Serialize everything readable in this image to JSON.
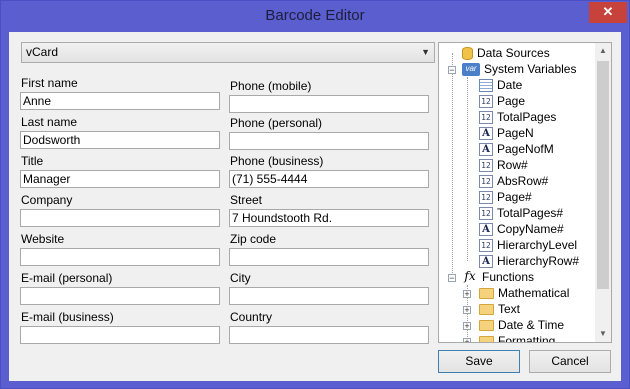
{
  "window": {
    "title": "Barcode Editor",
    "close_glyph": "✕"
  },
  "combo": {
    "value": "vCard",
    "arrow": "▼"
  },
  "fields": {
    "first_name": {
      "label": "First name",
      "value": "Anne"
    },
    "phone_mobile": {
      "label": "Phone (mobile)",
      "value": ""
    },
    "last_name": {
      "label": "Last name",
      "value": "Dodsworth"
    },
    "phone_personal": {
      "label": "Phone (personal)",
      "value": ""
    },
    "title": {
      "label": "Title",
      "value": "Manager"
    },
    "phone_business": {
      "label": "Phone (business)",
      "value": "(71) 555-4444"
    },
    "company": {
      "label": "Company",
      "value": ""
    },
    "street": {
      "label": "Street",
      "value": "7 Houndstooth Rd."
    },
    "website": {
      "label": "Website",
      "value": ""
    },
    "zip": {
      "label": "Zip code",
      "value": ""
    },
    "email_personal": {
      "label": "E-mail (personal)",
      "value": ""
    },
    "city": {
      "label": "City",
      "value": ""
    },
    "email_business": {
      "label": "E-mail (business)",
      "value": ""
    },
    "country": {
      "label": "Country",
      "value": ""
    }
  },
  "tree": {
    "data_sources": "Data Sources",
    "system_variables": "System Variables",
    "var_icon": "var",
    "num_icon": "12",
    "text_icon": "A",
    "fx_icon": "fx",
    "vars": [
      "Date",
      "Page",
      "TotalPages",
      "PageN",
      "PageNofM",
      "Row#",
      "AbsRow#",
      "Page#",
      "TotalPages#",
      "CopyName#",
      "HierarchyLevel",
      "HierarchyRow#"
    ],
    "functions": "Functions",
    "function_groups": [
      "Mathematical",
      "Text",
      "Date & Time",
      "Formatting"
    ],
    "collapse_glyph": "−",
    "expand_glyph": "+",
    "scroll_up": "▲",
    "scroll_down": "▼"
  },
  "buttons": {
    "save": "Save",
    "cancel": "Cancel"
  }
}
